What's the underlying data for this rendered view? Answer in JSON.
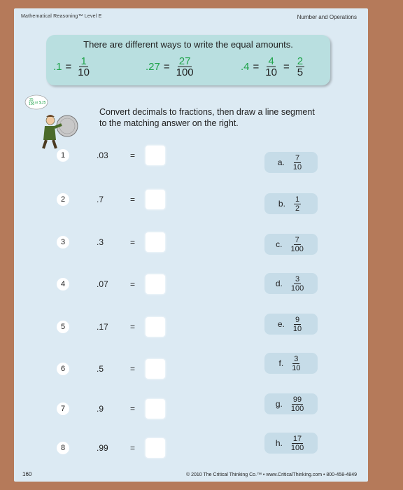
{
  "header": {
    "left": "Mathematical Reasoning™ Level E",
    "right": "Number and Operations"
  },
  "banner": {
    "text": "There are different ways to write the equal amounts.",
    "examples": [
      {
        "decimal": ".1",
        "num": "1",
        "den": "10"
      },
      {
        "decimal": ".27",
        "num": "27",
        "den": "100"
      },
      {
        "decimal": ".4",
        "num": "4",
        "den": "10",
        "num2": "2",
        "den2": "5"
      }
    ]
  },
  "speech": {
    "num": "25",
    "den": "100",
    "text": "or $.25"
  },
  "instructions": "Convert decimals to fractions, then draw a line segment to the matching answer on the right.",
  "problems": [
    {
      "n": "1",
      "decimal": ".03"
    },
    {
      "n": "2",
      "decimal": ".7"
    },
    {
      "n": "3",
      "decimal": ".3"
    },
    {
      "n": "4",
      "decimal": ".07"
    },
    {
      "n": "5",
      "decimal": ".17"
    },
    {
      "n": "6",
      "decimal": ".5"
    },
    {
      "n": "7",
      "decimal": ".9"
    },
    {
      "n": "8",
      "decimal": ".99"
    }
  ],
  "equals": "=",
  "answers": [
    {
      "label": "a.",
      "num": "7",
      "den": "10"
    },
    {
      "label": "b.",
      "num": "1",
      "den": "2"
    },
    {
      "label": "c.",
      "num": "7",
      "den": "100"
    },
    {
      "label": "d.",
      "num": "3",
      "den": "100"
    },
    {
      "label": "e.",
      "num": "9",
      "den": "10"
    },
    {
      "label": "f.",
      "num": "3",
      "den": "10"
    },
    {
      "label": "g.",
      "num": "99",
      "den": "100"
    },
    {
      "label": "h.",
      "num": "17",
      "den": "100"
    }
  ],
  "footer": {
    "page": "160",
    "copyright": "© 2010 The Critical Thinking Co.™ • www.CriticalThinking.com • 800-458-4849"
  }
}
